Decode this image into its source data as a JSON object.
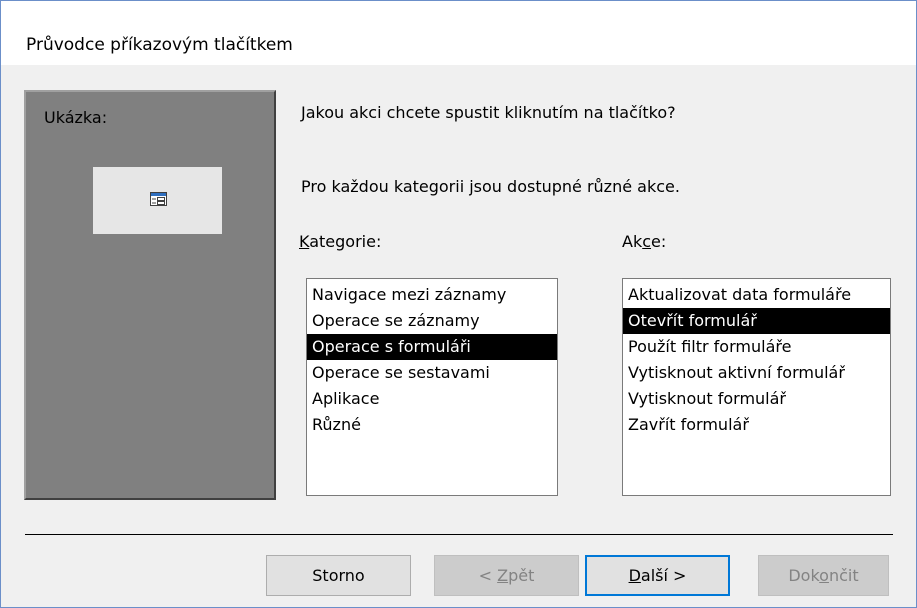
{
  "window": {
    "title": "Průvodce příkazovým tlačítkem"
  },
  "preview": {
    "label": "Ukázka:",
    "icon": "form-icon"
  },
  "question": "Jakou akci chcete spustit kliknutím na tlačítko?",
  "info": "Pro každou kategorii jsou dostupné různé akce.",
  "categories": {
    "label_pre": "",
    "label_accel": "K",
    "label_post": "ategorie:",
    "items": [
      "Navigace mezi záznamy",
      "Operace se záznamy",
      "Operace s formuláři",
      "Operace se sestavami",
      "Aplikace",
      "Různé"
    ],
    "selected": "Operace s formuláři"
  },
  "actions": {
    "label_pre": "Ak",
    "label_accel": "c",
    "label_post": "e:",
    "items": [
      "Aktualizovat data formuláře",
      "Otevřít formulář",
      "Použít filtr formuláře",
      "Vytisknout aktivní formulář",
      "Vytisknout formulář",
      "Zavřít formulář"
    ],
    "selected": "Otevřít formulář"
  },
  "buttons": {
    "cancel": {
      "label": "Storno"
    },
    "back": {
      "pre": "< ",
      "accel": "Z",
      "post": "pět"
    },
    "next": {
      "pre": "",
      "accel": "D",
      "post": "alší >"
    },
    "finish": {
      "pre": "Dok",
      "accel": "o",
      "post": "nčit"
    }
  },
  "colors": {
    "window_border": "#6b8fc9",
    "dialog_bg": "#f0f0f0",
    "preview_bg": "#808080",
    "selection_bg": "#000000",
    "selection_fg": "#ffffff",
    "default_button_border": "#0078d7",
    "disabled_text": "#838383"
  }
}
